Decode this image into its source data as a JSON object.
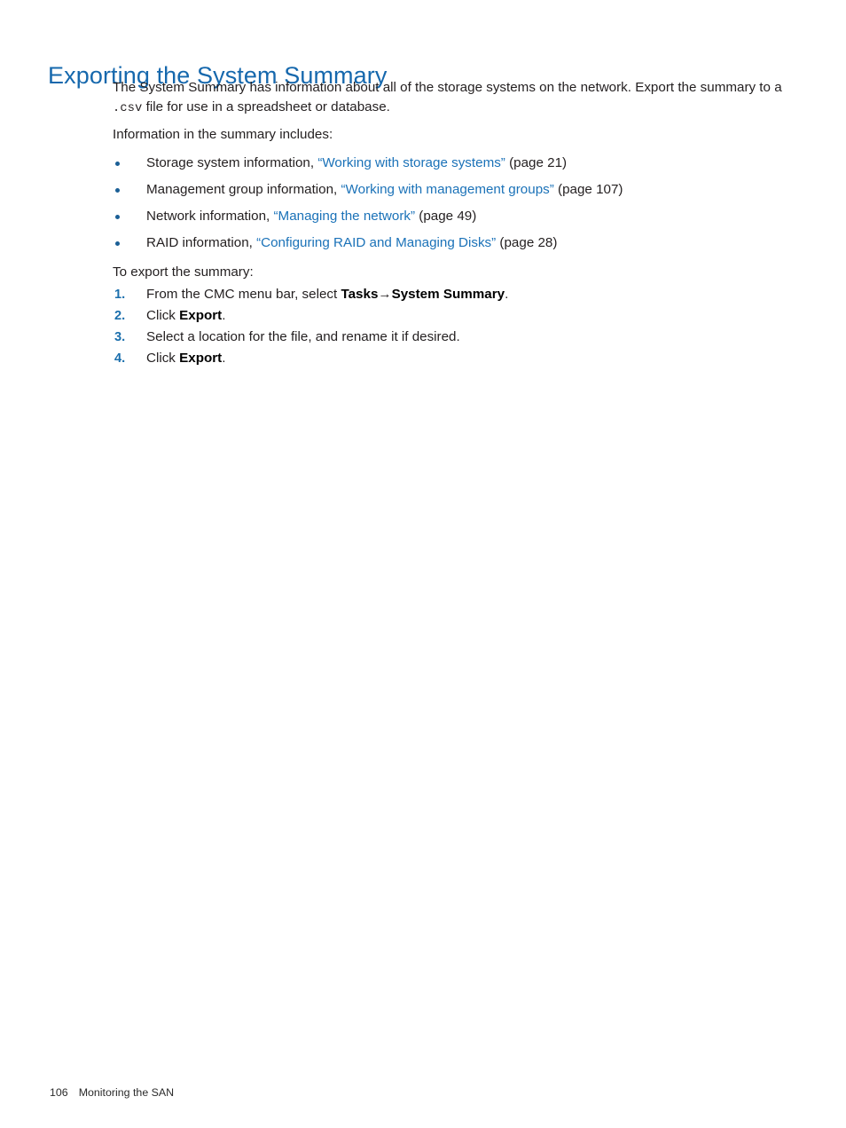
{
  "document": {
    "heading": "Exporting the System Summary",
    "intro_paragraph_part1": "The System Summary has information about all of the storage systems on the network. Export the summary to a ",
    "intro_paragraph_code": ".csv",
    "intro_paragraph_part2": " file for use in a spreadsheet or database.",
    "includes_lead_in": "Information in the summary includes:",
    "bullets": [
      {
        "text": "Storage system information, ",
        "link": "“Working with storage systems”",
        "page_ref": " (page 21)"
      },
      {
        "text": "Management group information, ",
        "link": "“Working with management groups”",
        "page_ref": " (page 107)"
      },
      {
        "text": "Network information, ",
        "link": "“Managing the network”",
        "page_ref": " (page 49)"
      },
      {
        "text": "RAID information, ",
        "link": "“Configuring RAID and Managing Disks”",
        "page_ref": " (page 28)"
      }
    ],
    "steps_lead_in": "To export the summary:",
    "steps": [
      {
        "marker": "1.",
        "prefix": "From the CMC menu bar, select ",
        "bold1": "Tasks",
        "arrow": "→",
        "bold2": "System Summary",
        "suffix": "."
      },
      {
        "marker": "2.",
        "prefix": "Click ",
        "bold1": "Export",
        "arrow": "",
        "bold2": "",
        "suffix": "."
      },
      {
        "marker": "3.",
        "prefix": "Select a location for the file, and rename it if desired.",
        "bold1": "",
        "arrow": "",
        "bold2": "",
        "suffix": ""
      },
      {
        "marker": "4.",
        "prefix": "Click ",
        "bold1": "Export",
        "arrow": "",
        "bold2": "",
        "suffix": "."
      }
    ],
    "footer": {
      "page_number": "106",
      "chapter_title": "Monitoring the SAN"
    },
    "colors": {
      "heading_blue": "#1668ad",
      "link_blue": "#1b72b8",
      "bullet_blue": "#1b5f96",
      "step_number_blue": "#1b6fad",
      "body_text": "#231f20",
      "page_background": "#ffffff"
    }
  }
}
